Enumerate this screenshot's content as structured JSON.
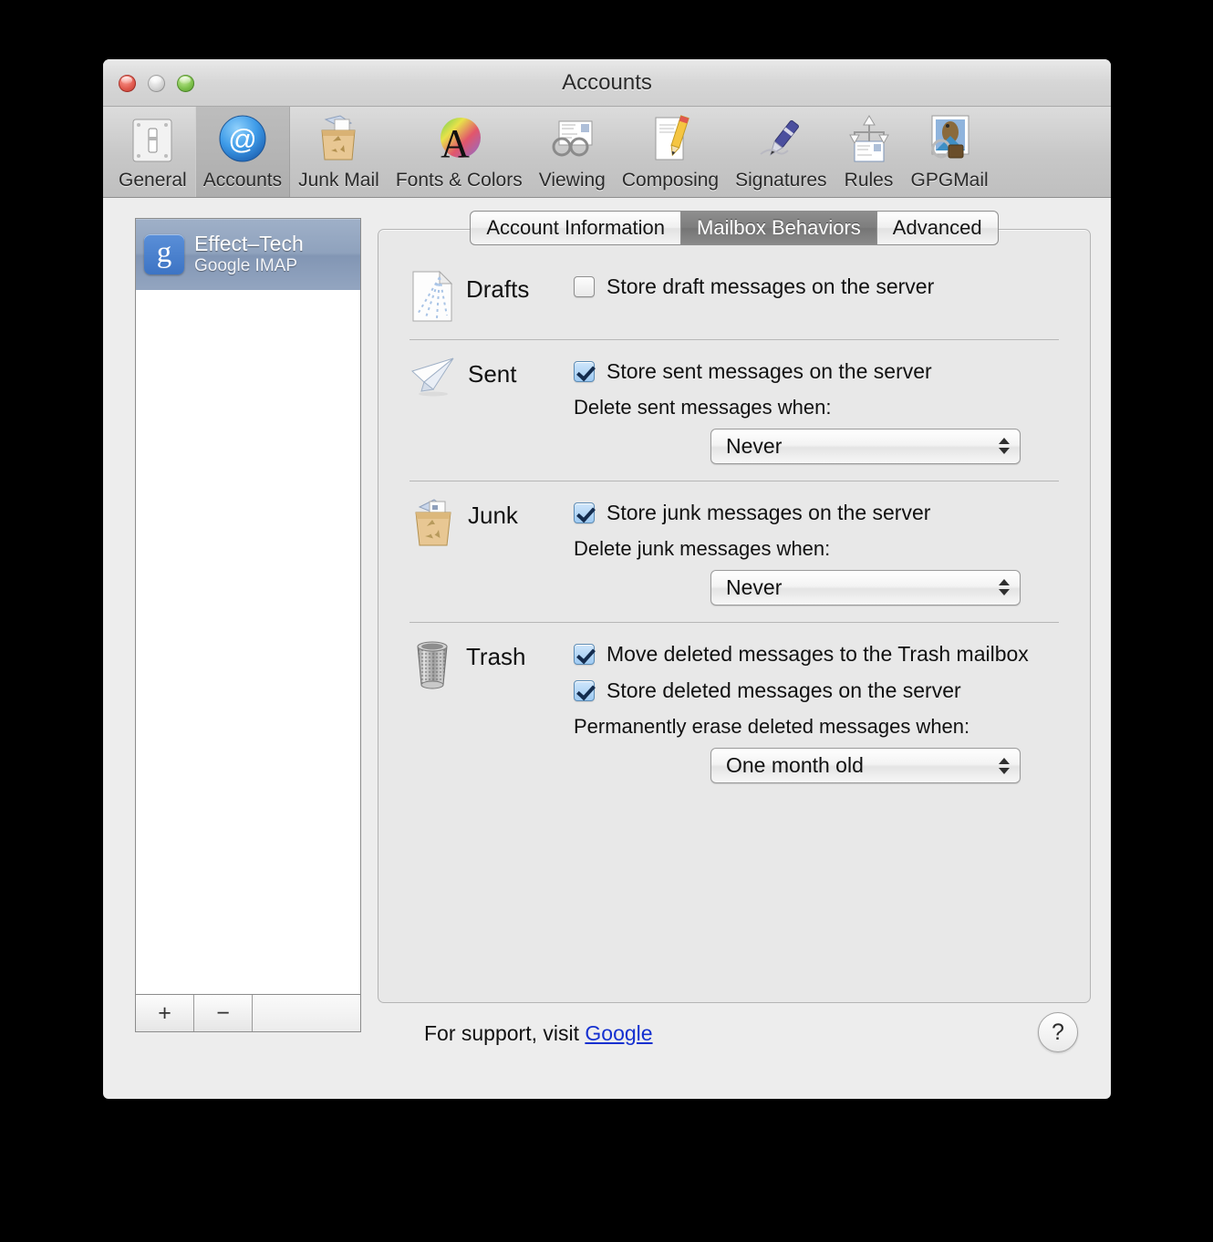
{
  "window": {
    "title": "Accounts",
    "controls": {
      "close": "close-button",
      "minimize": "minimize-button",
      "zoom": "zoom-button"
    }
  },
  "toolbar": {
    "items": [
      {
        "label": "General",
        "icon": "general-switch-icon",
        "selected": false
      },
      {
        "label": "Accounts",
        "icon": "at-sign-icon",
        "selected": true
      },
      {
        "label": "Junk Mail",
        "icon": "junk-bag-icon",
        "selected": false
      },
      {
        "label": "Fonts & Colors",
        "icon": "fonts-colors-icon",
        "selected": false
      },
      {
        "label": "Viewing",
        "icon": "glasses-icon",
        "selected": false
      },
      {
        "label": "Composing",
        "icon": "pencil-page-icon",
        "selected": false
      },
      {
        "label": "Signatures",
        "icon": "fountain-pen-icon",
        "selected": false
      },
      {
        "label": "Rules",
        "icon": "rules-arrows-icon",
        "selected": false
      },
      {
        "label": "GPGMail",
        "icon": "gpgmail-stamp-icon",
        "selected": false
      }
    ]
  },
  "accounts": {
    "list": [
      {
        "name": "Effect–Tech",
        "kind": "Google IMAP",
        "icon": "google-g-icon",
        "selected": true
      }
    ],
    "add_label": "+",
    "remove_label": "−"
  },
  "tabs": [
    {
      "label": "Account Information",
      "selected": false
    },
    {
      "label": "Mailbox Behaviors",
      "selected": true
    },
    {
      "label": "Advanced",
      "selected": false
    }
  ],
  "sections": {
    "drafts": {
      "title": "Drafts",
      "icon": "drafts-page-icon",
      "store_label": "Store draft messages on the server",
      "store_checked": false
    },
    "sent": {
      "title": "Sent",
      "icon": "sent-paper-plane-icon",
      "store_label": "Store sent messages on the server",
      "store_checked": true,
      "delete_label": "Delete sent messages when:",
      "delete_value": "Never"
    },
    "junk": {
      "title": "Junk",
      "icon": "junk-bag-icon",
      "store_label": "Store junk messages on the server",
      "store_checked": true,
      "delete_label": "Delete junk messages when:",
      "delete_value": "Never"
    },
    "trash": {
      "title": "Trash",
      "icon": "trash-can-icon",
      "move_label": "Move deleted messages to the Trash mailbox",
      "move_checked": true,
      "store_label": "Store deleted messages on the server",
      "store_checked": true,
      "erase_label": "Permanently erase deleted messages when:",
      "erase_value": "One month old"
    }
  },
  "footer": {
    "support_prefix": "For support, visit ",
    "support_link": "Google",
    "help_label": "?"
  },
  "colors": {
    "selection_blue": "#8fa2bd",
    "link_blue": "#1430d0",
    "google_blue": "#4a7fcc",
    "window_bg": "#ededed"
  }
}
